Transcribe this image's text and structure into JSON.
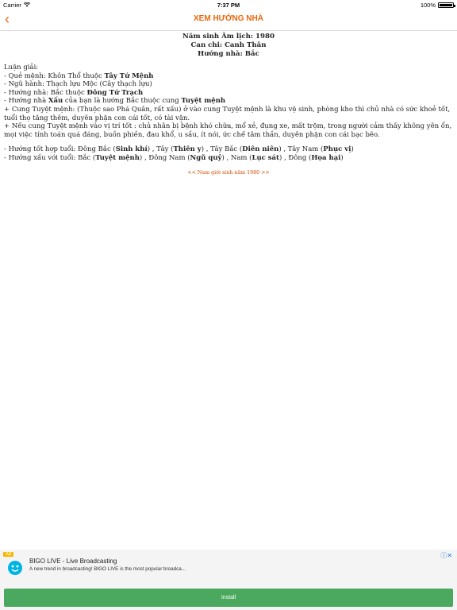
{
  "status_bar": {
    "carrier": "Carrier",
    "time": "7:37 PM",
    "battery": "100%"
  },
  "nav": {
    "back": "‹",
    "title": "XEM HƯỚNG NHÀ"
  },
  "header": {
    "line1": "Năm sinh Âm lịch: 1980",
    "line2": "Can chi: Canh Thân",
    "line3": "Hướng nhà: Bắc"
  },
  "body": {
    "intro": "Luận giải:",
    "l1a": "- Quẻ mệnh: Khôn Thổ thuộc ",
    "l1b": "Tây Tứ Mệnh",
    "l2": "- Ngũ hành: Thạch lựu Mộc (Cây thạch lựu)",
    "l3a": "- Hướng nhà: Bắc thuộc ",
    "l3b": "Đông Tứ Trạch",
    "l4a": "- Hướng nhà ",
    "l4b": "Xấu",
    "l4c": " của bạn là hướng Bắc thuộc cung ",
    "l4d": "Tuyệt mệnh",
    "p1": "+ Cung Tuyệt mệnh: (Thuộc sao Phá Quân, rất xấu) ở vào cung Tuyệt mệnh là khu vệ sinh, phòng kho thì chủ nhà có sức khoẻ tốt, tuổi thọ tăng thêm, duyên phận con cái tốt, có tài vận.",
    "p2": "+ Nếu cung Tuyệt mệnh vào vị trí tốt : chủ nhân bị bệnh khó chữa, mổ xẻ, đụng xe, mất trộm, trong người cảm thấy không yên ổn, mọi việc tính toán quá đáng, buồn phiền, đau khổ, u sầu, ít nói, ức chế tâm thần, duyên phận con cái bạc bẽo.",
    "good_prefix": "- Hướng tốt hợp tuổi: Đông Bắc (",
    "good_1": "Sinh khí",
    "good_sep1": ") , Tây (",
    "good_2": "Thiên y",
    "good_sep2": ") , Tây Bắc (",
    "good_3": "Diên niên",
    "good_sep3": ") , Tây Nam (",
    "good_4": "Phục vị",
    "good_end": ")",
    "bad_prefix": "- Hướng xấu với tuổi: Bắc (",
    "bad_1": "Tuyệt mệnh",
    "bad_sep1": ") , Đông Nam (",
    "bad_2": "Ngũ quỷ",
    "bad_sep2": ") , Nam (",
    "bad_3": "Lục sát",
    "bad_sep3": ") , Đông (",
    "bad_4": "Họa hại",
    "bad_end": ")"
  },
  "link": "<< Nam giới sinh năm 1980 >>",
  "ad": {
    "badge": "Ad",
    "title": "BIGO LIVE - Live Broadcasting",
    "desc": "A new trend in broadcasting! BIGO LIVE is the most popular broadca...",
    "install": "Install"
  }
}
